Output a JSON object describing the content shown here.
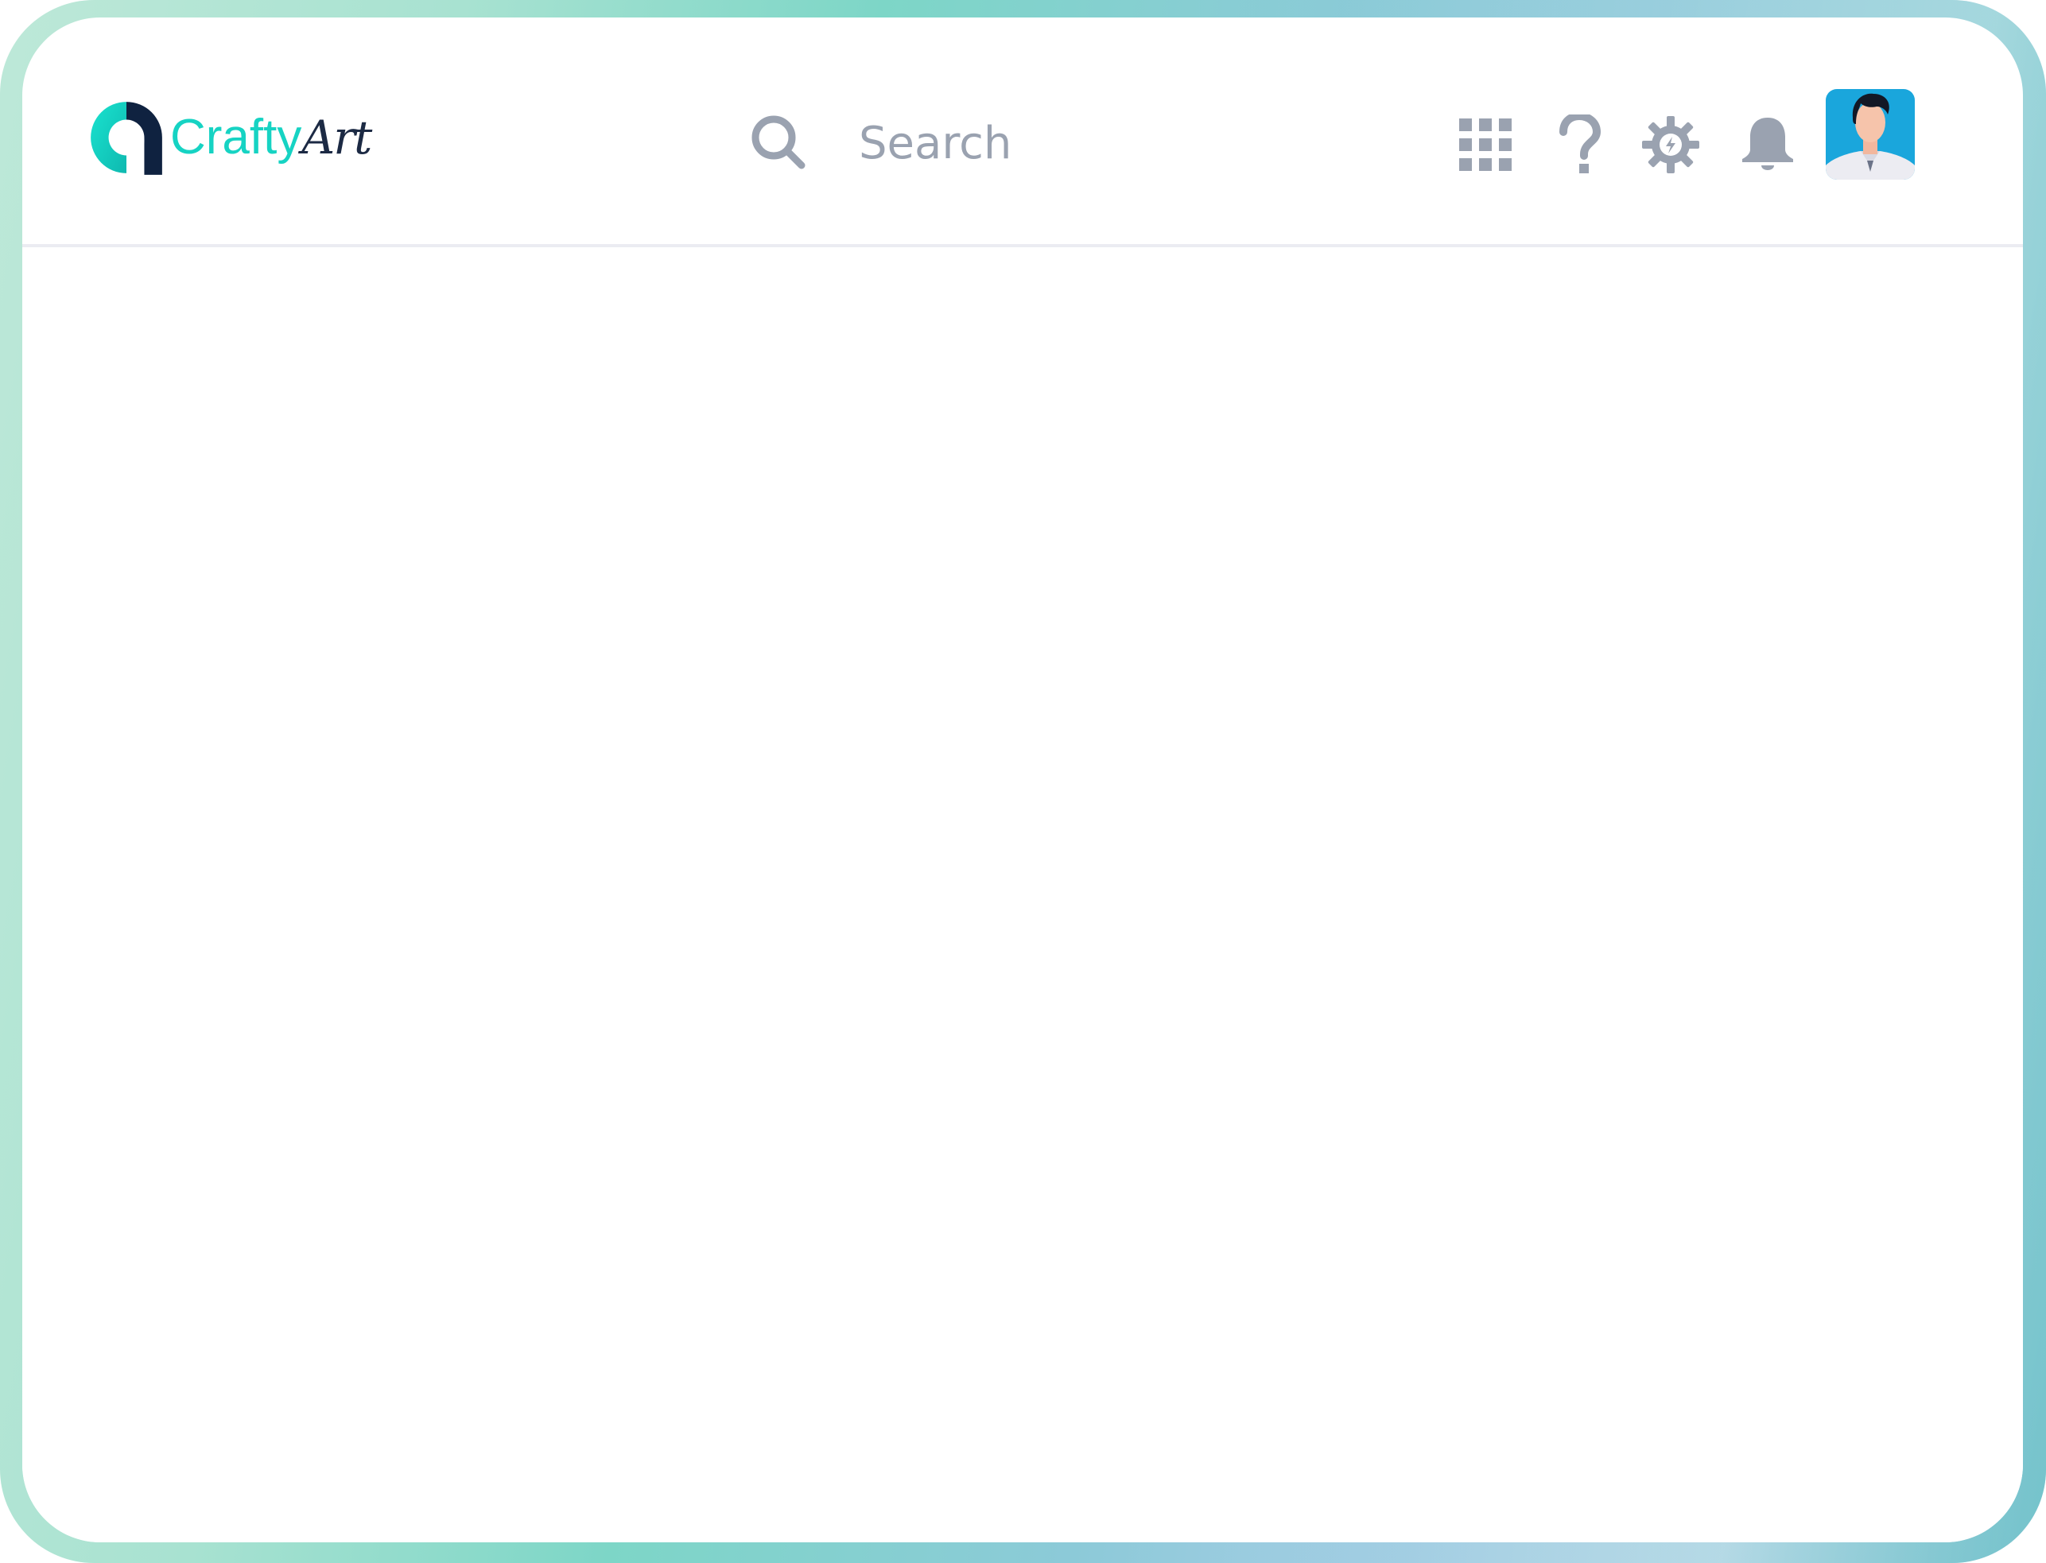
{
  "brand": {
    "name_primary": "Crafty",
    "name_secondary": "Art",
    "primary_color": "#16d3c3",
    "secondary_color": "#1c2a44"
  },
  "search": {
    "placeholder": "Search",
    "value": "",
    "icon": "search-icon"
  },
  "toolbar": {
    "icons": [
      "apps-grid-icon",
      "help-icon",
      "settings-icon",
      "notifications-bell-icon"
    ],
    "icon_color": "#9aa2b0"
  },
  "user": {
    "avatar_bg": "#1aa6dc"
  },
  "theme": {
    "divider_color": "#ebecf2"
  }
}
